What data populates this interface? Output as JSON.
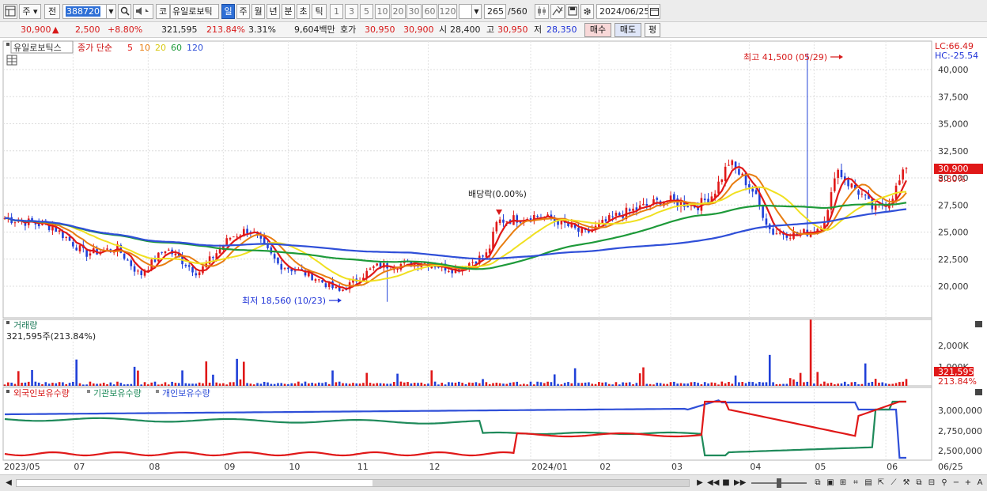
{
  "toolbar": {
    "type_label": "주",
    "prev_label": "전",
    "code": "388720",
    "market_label": "코",
    "name": "유일로보틱",
    "periods": [
      "일",
      "주",
      "월",
      "년",
      "분",
      "초",
      "틱"
    ],
    "active_period": "일",
    "intervals": [
      "1",
      "3",
      "5",
      "10",
      "20",
      "30",
      "60",
      "120"
    ],
    "count": "265",
    "total": "/560",
    "date": "2024/06/25"
  },
  "quote": {
    "price": "30,900",
    "arrow": "▲",
    "change": "2,500",
    "change_pct": "+8.80%",
    "volume": "321,595",
    "vol_ratio": "213.84%",
    "turnover_pct": "3.31%",
    "amount": "9,604백만",
    "ask_label": "호가",
    "ask": "30,950",
    "bid": "30,900",
    "open_label": "시",
    "open": "28,400",
    "high_label": "고",
    "high": "30,950",
    "low_label": "저",
    "low": "28,350",
    "buy_label": "매수",
    "sell_label": "매도",
    "eval_label": "평"
  },
  "price_panel": {
    "title": "유일로보틱스",
    "ma_label": "종가 단순",
    "ma_periods": [
      "5",
      "10",
      "20",
      "60",
      "120"
    ],
    "ma_colors": [
      "#e01818",
      "#e87d10",
      "#f0e020",
      "#1e9a3a",
      "#2f4fd8"
    ],
    "lc": "LC:66.49",
    "hc": "HC:-25.54",
    "y_ticks": [
      "40,000",
      "37,500",
      "35,000",
      "32,500",
      "30,000",
      "27,500",
      "25,000",
      "22,500",
      "20,000"
    ],
    "high_annotation": "최고 41,500 (05/29)",
    "low_annotation": "최저 18,560 (10/23)",
    "dividend_annotation": "배당락(0.00%)",
    "last_price": "30,900",
    "last_pct": "8.80%"
  },
  "volume_panel": {
    "title": "거래량",
    "value": "321,595주(213.84%)",
    "y_ticks": [
      "2,000K",
      "1,000K"
    ],
    "last_volume": "321,595",
    "last_pct": "213.84%"
  },
  "holdings_panel": {
    "series": [
      "외국인보유수량",
      "기관보유수량",
      "개인보유수량"
    ],
    "colors": [
      "#e01818",
      "#1e8a5a",
      "#2f4fd8"
    ],
    "y_ticks": [
      "3,000,000",
      "2,750,000",
      "2,500,000"
    ]
  },
  "x_axis": {
    "labels": [
      "2023/05",
      "07",
      "08",
      "09",
      "10",
      "11",
      "12",
      "2024/01",
      "02",
      "03",
      "04",
      "05",
      "06"
    ],
    "last_label": "06/25"
  },
  "colors": {
    "up": "#e01818",
    "down": "#2040d8",
    "accent": "#2e6fd6"
  }
}
